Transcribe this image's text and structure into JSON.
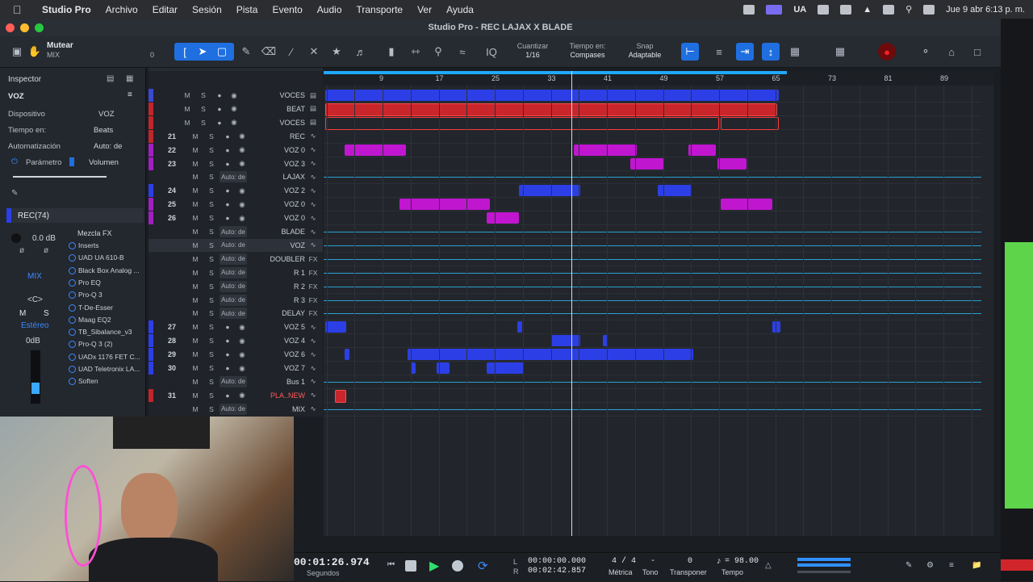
{
  "menubar": {
    "app": "Studio Pro",
    "items": [
      "Archivo",
      "Editar",
      "Sesión",
      "Pista",
      "Evento",
      "Audio",
      "Transporte",
      "Ver",
      "Ayuda"
    ],
    "keyboard": "UA",
    "clock": "Jue 9 abr  6:13 p. m."
  },
  "window": {
    "title": "Studio Pro - REC LAJAX X BLADE"
  },
  "toolbar": {
    "mute_label": "Mutear",
    "mute_sub": "MIX",
    "mute_value": "0",
    "quantize_label": "Cuantizar",
    "quantize_value": "1/16",
    "timebase_label": "Tiempo en:",
    "timebase_value": "Compases",
    "snap_label": "Snap",
    "snap_value": "Adaptable"
  },
  "inspector": {
    "title": "Inspector",
    "track_name": "VOZ",
    "device_label": "Dispositivo",
    "device_value": "VOZ",
    "time_label": "Tiempo en:",
    "time_value": "Beats",
    "automation_label": "Automatización",
    "automation_value": "Auto: de",
    "param_label": "Parámetro",
    "param_value": "Volumen",
    "channel_name": "REC(74)",
    "gain": "0.0 dB",
    "mix_label": "MIX",
    "pan": "<C>",
    "m": "M",
    "s": "S",
    "stereo": "Estéreo",
    "fader_db": "0dB",
    "fx_chain": "Mezcla FX",
    "inserts_label": "Inserts",
    "inserts": [
      "UAD UA 610-B",
      "Black Box Analog ...",
      "Pro EQ",
      "Pro-Q 3",
      "T-De-Esser",
      "Maag EQ2",
      "TB_Sibalance_v3",
      "Pro-Q 3 (2)",
      "UADx 1176 FET C...",
      "UAD Teletronix LA...",
      "Soften"
    ]
  },
  "tracks": [
    {
      "num": "",
      "name": "VOCES",
      "auto": "",
      "color": "#3a4ad0",
      "kind": "folder"
    },
    {
      "num": "",
      "name": "BEAT",
      "auto": "",
      "color": "#c0262b",
      "kind": "folder"
    },
    {
      "num": "",
      "name": "VOCES",
      "auto": "",
      "color": "#c0262b",
      "kind": "folder"
    },
    {
      "num": "21",
      "name": "REC",
      "auto": "",
      "color": "#c0262b",
      "kind": "audio"
    },
    {
      "num": "22",
      "name": "VOZ 0",
      "auto": "",
      "color": "#a020c0",
      "kind": "audio"
    },
    {
      "num": "23",
      "name": "VOZ 3",
      "auto": "",
      "color": "#a020c0",
      "kind": "audio"
    },
    {
      "num": "",
      "name": "LAJAX",
      "auto": "Auto: de",
      "color": "",
      "kind": "bus"
    },
    {
      "num": "24",
      "name": "VOZ 2",
      "auto": "",
      "color": "#2c3fe6",
      "kind": "audio"
    },
    {
      "num": "25",
      "name": "VOZ 0",
      "auto": "",
      "color": "#a020c0",
      "kind": "audio"
    },
    {
      "num": "26",
      "name": "VOZ 0",
      "auto": "",
      "color": "#a020c0",
      "kind": "audio"
    },
    {
      "num": "",
      "name": "BLADE",
      "auto": "Auto: de",
      "color": "",
      "kind": "bus"
    },
    {
      "num": "",
      "name": "VOZ",
      "auto": "Auto: de",
      "color": "",
      "kind": "bus",
      "selected": true
    },
    {
      "num": "",
      "name": "DOUBLER",
      "auto": "Auto: de",
      "color": "",
      "kind": "fx"
    },
    {
      "num": "",
      "name": "R 1",
      "auto": "Auto: de",
      "color": "",
      "kind": "fx"
    },
    {
      "num": "",
      "name": "R 2",
      "auto": "Auto: de",
      "color": "",
      "kind": "fx"
    },
    {
      "num": "",
      "name": "R 3",
      "auto": "Auto: de",
      "color": "",
      "kind": "fx"
    },
    {
      "num": "",
      "name": "DELAY",
      "auto": "Auto: de",
      "color": "",
      "kind": "fx"
    },
    {
      "num": "27",
      "name": "VOZ 5",
      "auto": "",
      "color": "#2c3fe6",
      "kind": "audio"
    },
    {
      "num": "28",
      "name": "VOZ 4",
      "auto": "",
      "color": "#2c3fe6",
      "kind": "audio"
    },
    {
      "num": "29",
      "name": "VOZ 6",
      "auto": "",
      "color": "#2c3fe6",
      "kind": "audio"
    },
    {
      "num": "30",
      "name": "VOZ 7",
      "auto": "",
      "color": "#2c3fe6",
      "kind": "audio"
    },
    {
      "num": "",
      "name": "Bus 1",
      "auto": "Auto: de",
      "color": "",
      "kind": "bus"
    },
    {
      "num": "31",
      "name": "PLA..NEW",
      "auto": "",
      "color": "#c0262b",
      "kind": "inst"
    },
    {
      "num": "",
      "name": "MIX",
      "auto": "Auto: de",
      "color": "",
      "kind": "bus"
    }
  ],
  "track_buttons": {
    "m": "M",
    "s": "S"
  },
  "ruler": [
    "9",
    "17",
    "25",
    "33",
    "41",
    "49",
    "57",
    "65",
    "73",
    "81",
    "89"
  ],
  "transport": {
    "time": "00:01:26.974",
    "time_unit": "Segundos",
    "loop_l": "00:00:00.000",
    "loop_r": "00:02:42.857",
    "l": "L",
    "r": "R",
    "meter_value": "4 / 4",
    "meter_label": "Métrica",
    "key_value": "-",
    "key_label": "Tono",
    "transpose_value": "0",
    "transpose_label": "Transponer",
    "tempo_value": "= 98.00",
    "tempo_label": "Tempo"
  },
  "colors": {
    "accent": "#1f6fe0",
    "magenta": "#c016d0",
    "blue": "#2c3fe6",
    "red": "#c9262b"
  }
}
